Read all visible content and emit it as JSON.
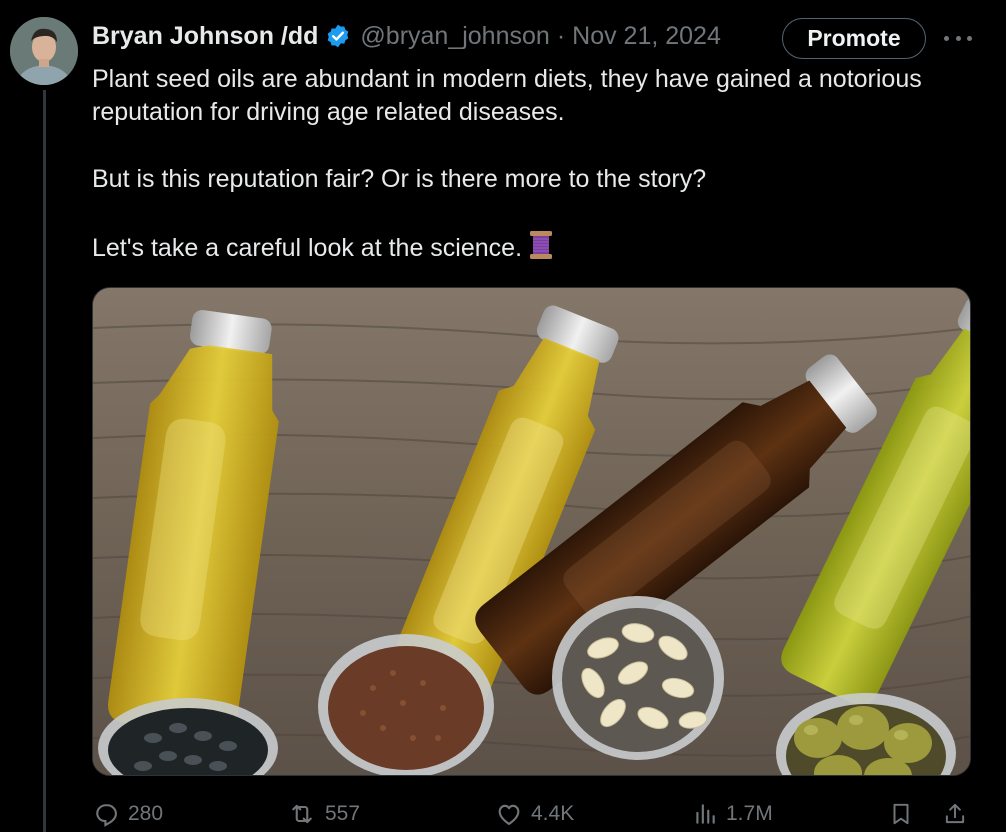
{
  "author": {
    "display_name": "Bryan Johnson /dd",
    "handle": "@bryan_johnson",
    "date": "Nov 21, 2024",
    "separator": "·",
    "verified": true
  },
  "buttons": {
    "promote_label": "Promote"
  },
  "tweet": {
    "paragraphs": [
      "Plant seed oils are abundant in modern diets, they have gained a notorious reputation for driving age related diseases.",
      "But is this reputation fair? Or is there more to the story?",
      "Let's take a careful look at the science."
    ],
    "emoji": "thread-spool-icon"
  },
  "actions": {
    "replies": "280",
    "reposts": "557",
    "likes": "4.4K",
    "views": "1.7M"
  },
  "icons": [
    "verified-badge-icon",
    "more-icon",
    "reply-icon",
    "repost-icon",
    "like-icon",
    "views-icon",
    "bookmark-icon",
    "share-icon"
  ],
  "colors": {
    "background": "#000000",
    "text_primary": "#e7e9ea",
    "text_secondary": "#71767b",
    "verified_blue": "#1d9bf0",
    "border": "#2f3336"
  }
}
